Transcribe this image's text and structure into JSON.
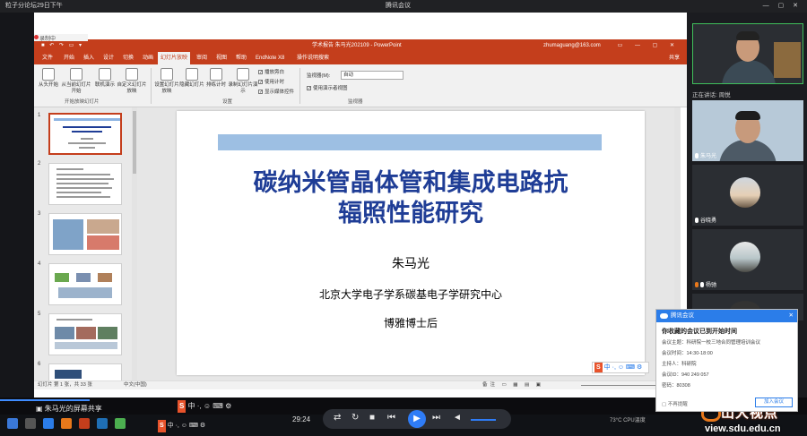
{
  "meeting_window": {
    "left_title": "粒子分论坛29日下午",
    "title": "腾讯会议",
    "controls": "— ▢ ✕"
  },
  "recording": {
    "label": "录制中"
  },
  "ppt": {
    "quick_access": "■ ↶ ↷ ▭ ▾",
    "window_title": "学术报告 朱马光202109 - PowerPoint",
    "user": "zhumaguang@163.com",
    "window_buttons": "▭ — ▢ ✕",
    "tabs": [
      "文件",
      "开始",
      "插入",
      "设计",
      "切换",
      "动画",
      "幻灯片放映",
      "审阅",
      "视图",
      "帮助",
      "EndNote X8",
      "操作说明搜索"
    ],
    "active_tab": "幻灯片放映",
    "share": "共享",
    "ribbon": {
      "buttons": [
        "从头开始",
        "从当前幻灯片开始",
        "联机演示",
        "自定义幻灯片放映",
        "设置幻灯片放映",
        "隐藏幻灯片",
        "排练计时",
        "录制幻灯片演示"
      ],
      "groups": [
        "开始放映幻灯片",
        "设置",
        "监视器"
      ],
      "checkboxes": [
        "播放旁白",
        "使用计时",
        "显示媒体控件"
      ],
      "monitor_label": "监视器(M):",
      "monitor_value": "自动",
      "presenter_view": "使用演示者视图"
    },
    "thumbnails": [
      "1",
      "2",
      "3",
      "4",
      "5",
      "6"
    ],
    "slide": {
      "title_line1": "碳纳米管晶体管和集成电路抗",
      "title_line2": "辐照性能研究",
      "author": "朱马光",
      "institution": "北京大学电子学系碳基电子学研究中心",
      "position": "博雅博士后"
    },
    "status": {
      "slide": "幻灯片 第 1 张，共 33 张",
      "lang": "中文(中国)",
      "view_icons": "备注 ▭ ▦ ▤ ▣"
    }
  },
  "ime": {
    "logo": "S",
    "text": "中 ·, ☺ ⌨ ⚙"
  },
  "participants": {
    "speaking": "正在讲话: 周悦",
    "tiles": [
      {
        "name": ""
      },
      {
        "name": "朱马光"
      },
      {
        "name": "谷晓勇"
      },
      {
        "name": "杨驰"
      },
      {
        "name": ""
      }
    ]
  },
  "notification": {
    "app": "腾讯会议",
    "heading": "你收藏的会议已到开始时间",
    "topic": "会议主题：科研院一校三地合同管理培训会议",
    "time": "会议时间：14:30-18:00",
    "host": "主持人：科研院",
    "meeting_id": "会议ID：940 249 057",
    "password": "密码：80308",
    "no_remind": "不再提醒",
    "join": "加入会议"
  },
  "bottom": {
    "screen_share": "朱马光的屏幕共享",
    "time": "29:24",
    "system": "73°C  CPU温度"
  },
  "watermark": {
    "line1": "山大视点",
    "line2": "view.sdu.edu.cn"
  },
  "colors": {
    "ppt_accent": "#c43e1c",
    "slide_title": "#1f3d96",
    "meeting_blue": "#2b7de9"
  }
}
